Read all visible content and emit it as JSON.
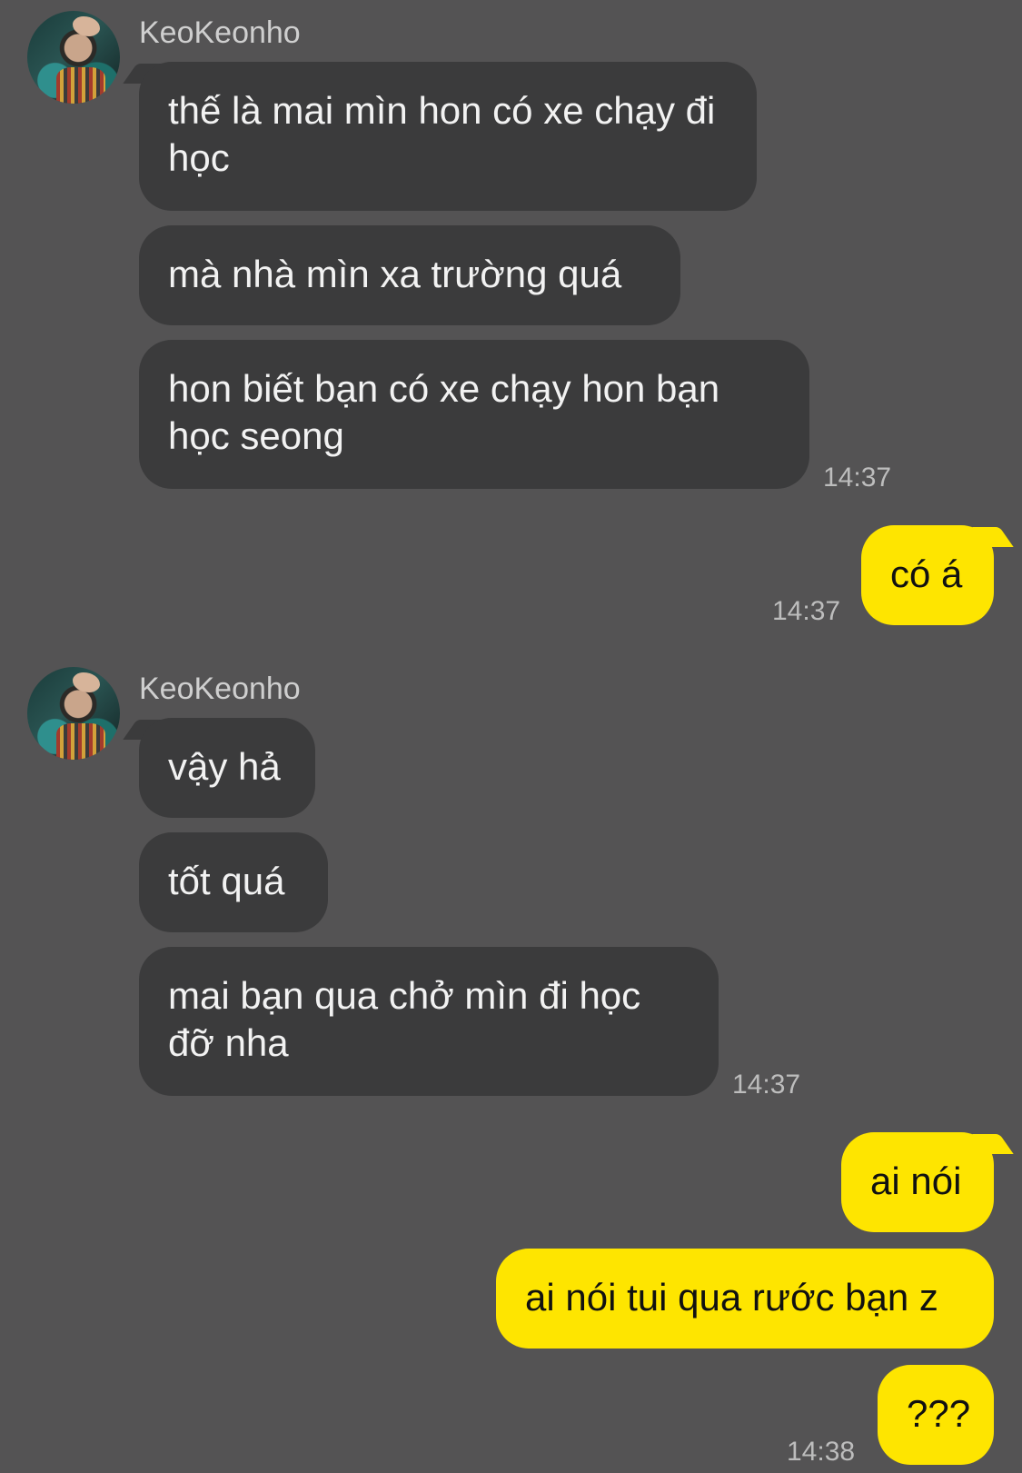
{
  "conversation": {
    "groups": [
      {
        "sender": "KeoKeonho",
        "avatar_icon": "profile-photo",
        "messages": [
          "thế là mai mìn hon có xe chạy đi học",
          "mà nhà mìn xa trường quá",
          "hon biết bạn có xe chạy hon bạn học seong"
        ],
        "time": "14:37"
      },
      {
        "sender": "me",
        "messages": [
          "có á"
        ],
        "time": "14:37"
      },
      {
        "sender": "KeoKeonho",
        "avatar_icon": "profile-photo",
        "messages": [
          "vậy hả",
          "tốt quá",
          "mai bạn qua chở mìn đi học đỡ nha"
        ],
        "time": "14:37"
      },
      {
        "sender": "me",
        "messages": [
          "ai nói",
          "ai nói tui qua rước bạn z",
          "???"
        ],
        "time": "14:38"
      }
    ]
  },
  "colors": {
    "background": "#545354",
    "incoming_bubble": "#3b3b3c",
    "outgoing_bubble": "#fee500",
    "timestamp_text": "#bdbdbd"
  }
}
